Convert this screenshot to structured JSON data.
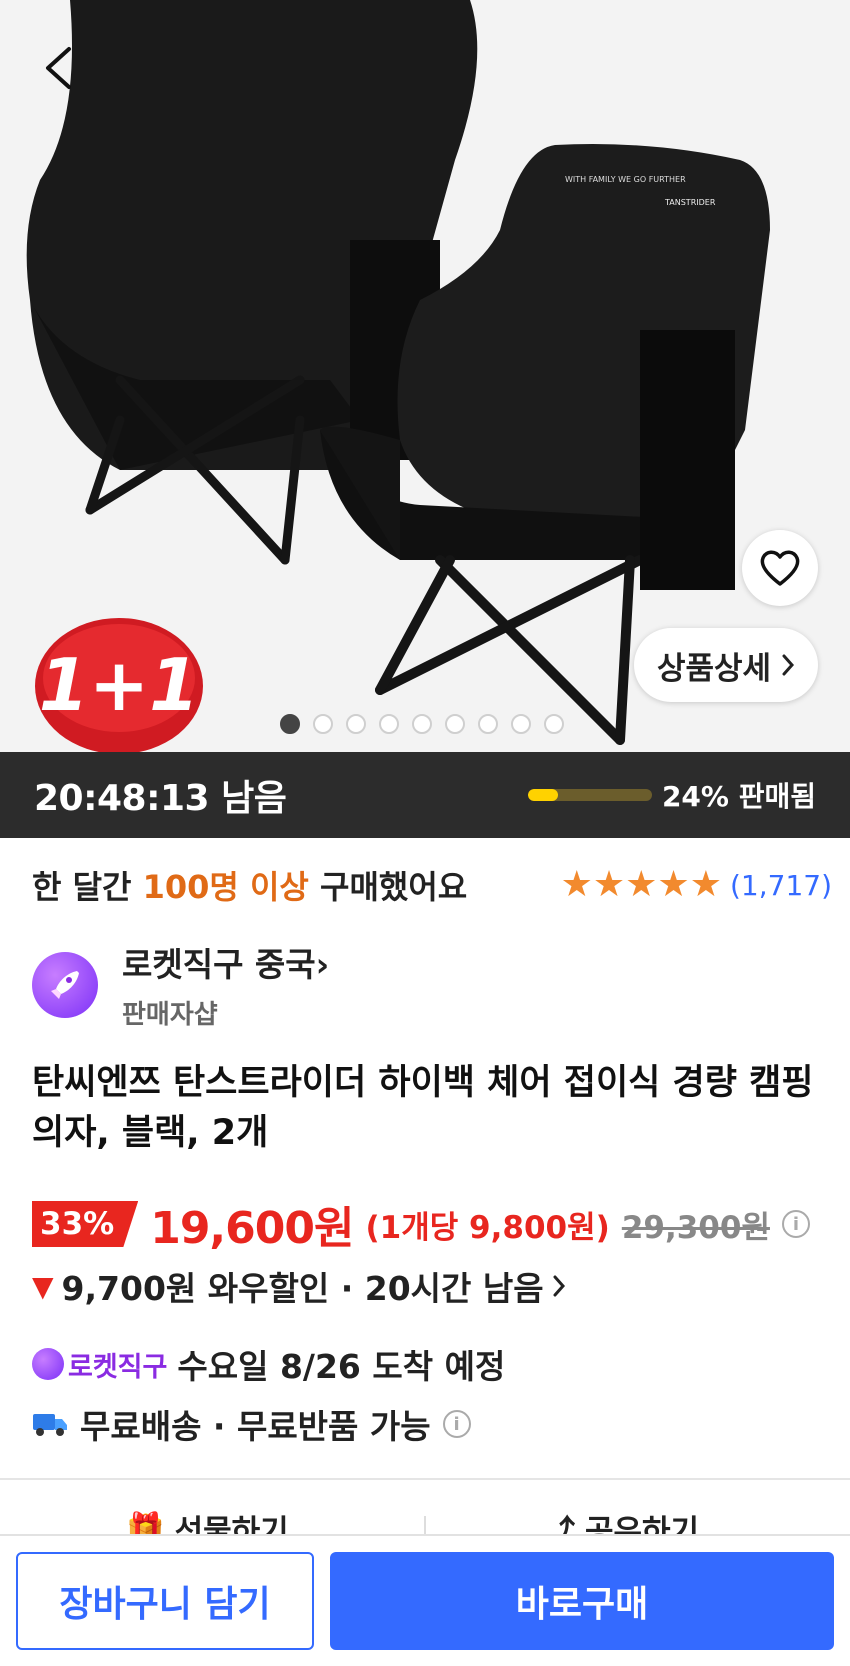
{
  "hero": {
    "promo_badge": "1+1",
    "detail_button_label": "상품상세",
    "image_count": 9,
    "active_index": 0,
    "product_logo_text": "TANSTRIDER",
    "product_tagline": "WITH FAMILY WE GO FURTHER"
  },
  "timer": {
    "countdown": "20:48:13 남음",
    "sold_label": "24% 판매됨",
    "sold_fraction": 0.24
  },
  "buyers": {
    "prefix": "한 달간",
    "highlight": "100명 이상",
    "suffix": "구매했어요",
    "rating_stars": 5,
    "review_count": "(1,717)"
  },
  "seller": {
    "name": "로켓직구 중국",
    "sub_label": "판매자샵"
  },
  "product": {
    "title": "탄씨엔쯔 탄스트라이더 하이백 체어 접이식 경량 캠핑의자, 블랙, 2개"
  },
  "price": {
    "discount": "33%",
    "sale_price": "19,600원",
    "unit_price": "(1개당 9,800원)",
    "original_price": "29,300원",
    "info_icon": "i"
  },
  "wow": {
    "text": "9,700원 와우할인 · 20시간 남음"
  },
  "delivery": {
    "badge_label": "로켓직구",
    "arrival_text": "수요일 8/26 도착 예정",
    "shipping_text": "무료배송 · 무료반품 가능"
  },
  "actions": {
    "gift_label": "선물하기",
    "share_label": "공유하기"
  },
  "bottom": {
    "cart_label": "장바구니 담기",
    "buy_label": "바로구매"
  },
  "colors": {
    "accent_blue": "#346aff",
    "sale_red": "#e8261f",
    "star_orange": "#f28a2e",
    "highlight_orange": "#e06a16",
    "rocket_purple": "#8a2be2",
    "timer_bg": "#2c2c2c",
    "progress_yellow": "#ffd200"
  }
}
